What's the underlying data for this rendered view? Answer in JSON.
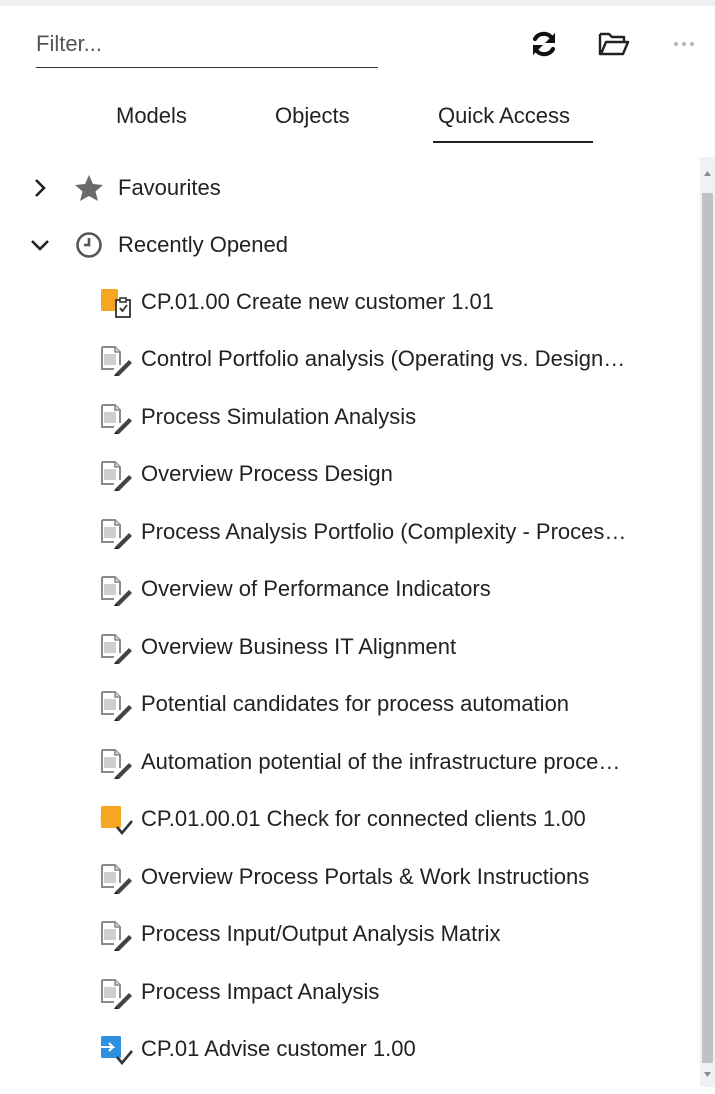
{
  "filter": {
    "placeholder": "Filter..."
  },
  "toolbar": {
    "refresh_icon": "refresh-icon",
    "folder_icon": "open-folder-icon",
    "more_icon": "more-icon"
  },
  "tabs": [
    {
      "label": "Models",
      "active": false
    },
    {
      "label": "Objects",
      "active": false
    },
    {
      "label": "Quick Access",
      "active": true
    }
  ],
  "groups": {
    "favourites": {
      "label": "Favourites",
      "expanded": false,
      "icon": "star-icon"
    },
    "recent": {
      "label": "Recently Opened",
      "expanded": true,
      "icon": "clock-icon"
    }
  },
  "recent_items": [
    {
      "label": "CP.01.00 Create new customer 1.01",
      "icon": "model-checklist-icon"
    },
    {
      "label": "Control Portfolio analysis (Operating vs. Design…",
      "icon": "analysis-edit-icon"
    },
    {
      "label": "Process Simulation Analysis",
      "icon": "analysis-edit-icon"
    },
    {
      "label": "Overview Process Design",
      "icon": "analysis-edit-icon"
    },
    {
      "label": "Process Analysis Portfolio (Complexity - Proces…",
      "icon": "analysis-edit-icon"
    },
    {
      "label": "Overview of Performance Indicators",
      "icon": "analysis-edit-icon"
    },
    {
      "label": "Overview Business IT Alignment",
      "icon": "analysis-edit-icon"
    },
    {
      "label": "Potential candidates for process automation",
      "icon": "analysis-edit-icon"
    },
    {
      "label": "Automation potential of the infrastructure proce…",
      "icon": "analysis-edit-icon"
    },
    {
      "label": "CP.01.00.01 Check for connected clients 1.00",
      "icon": "model-approved-icon"
    },
    {
      "label": "Overview Process Portals & Work Instructions",
      "icon": "analysis-edit-icon"
    },
    {
      "label": "Process Input/Output Analysis Matrix",
      "icon": "analysis-edit-icon"
    },
    {
      "label": "Process Impact Analysis",
      "icon": "analysis-edit-icon"
    },
    {
      "label": "CP.01 Advise customer 1.00",
      "icon": "model-released-icon"
    }
  ],
  "colors": {
    "accent_orange": "#f5a623",
    "accent_blue": "#2f8fe0",
    "icon_gray": "#6a6a6a"
  }
}
